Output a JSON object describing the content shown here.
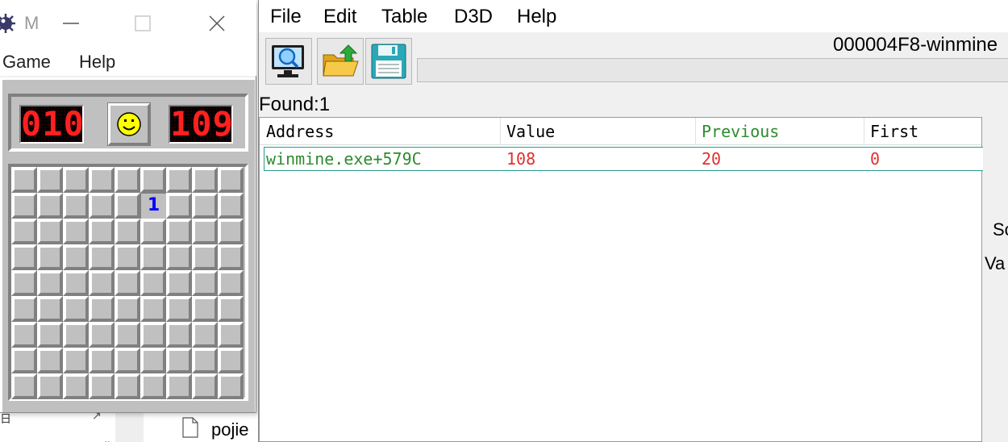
{
  "minesweeper": {
    "title": "M",
    "menu": {
      "game": "Game",
      "help": "Help"
    },
    "mine_counter": "010",
    "timer": "109",
    "face": "smiley",
    "board": {
      "rows": 9,
      "cols": 9,
      "revealed": [
        {
          "row": 1,
          "col": 5,
          "value": "1"
        }
      ]
    }
  },
  "background": {
    "file_label": "pojie",
    "left_glyph": "日",
    "arrow_glyph": "↗",
    "tick_glyph": "⌄"
  },
  "cheat_engine": {
    "menu": [
      "File",
      "Edit",
      "Table",
      "D3D",
      "Help"
    ],
    "process_title": "000004F8-winmine",
    "found_label": "Found:1",
    "columns": {
      "address": "Address",
      "value": "Value",
      "previous": "Previous",
      "first": "First"
    },
    "results": [
      {
        "address": "winmine.exe+579C",
        "value": "108",
        "previous": "20",
        "first": "0"
      }
    ],
    "side_labels": [
      "Sc",
      "Va"
    ],
    "colors": {
      "address_green": "#2e8b2e",
      "value_red": "#e03030",
      "selection_teal": "#2a9d8f"
    }
  }
}
